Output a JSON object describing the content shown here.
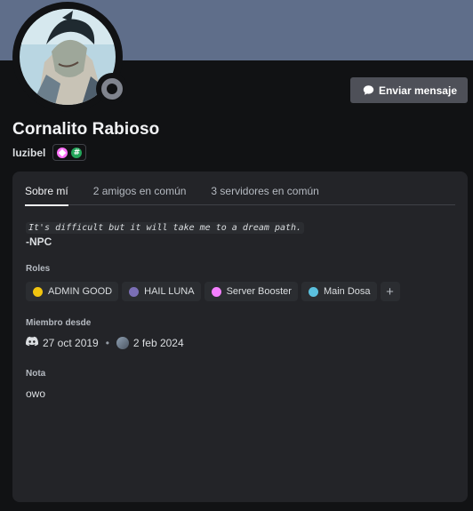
{
  "profile": {
    "display_name": "Cornalito Rabioso",
    "username": "luzibel",
    "badges": [
      "nitro-badge-icon",
      "hash-badge-icon"
    ],
    "hash_badge_text": "#",
    "status": "offline"
  },
  "actions": {
    "message_label": "Enviar mensaje"
  },
  "tabs": [
    {
      "label": "Sobre mí",
      "active": true
    },
    {
      "label": "2 amigos en común",
      "active": false
    },
    {
      "label": "3 servidores en común",
      "active": false
    }
  ],
  "bio": {
    "quote": "It's difficult but it will take me to a dream path.",
    "signature": "-NPC"
  },
  "roles": {
    "title": "Roles",
    "items": [
      {
        "name": "ADMIN GOOD",
        "color": "#f1c40f"
      },
      {
        "name": "HAIL LUNA",
        "color": "#7b6fb5"
      },
      {
        "name": "Server Booster",
        "color": "#f47fff"
      },
      {
        "name": "Main Dosa",
        "color": "#5bc0de"
      }
    ],
    "add_label": "+"
  },
  "member_since": {
    "title": "Miembro desde",
    "discord_date": "27 oct 2019",
    "separator": "•",
    "server_date": "2 feb 2024"
  },
  "note": {
    "title": "Nota",
    "value": "owo"
  },
  "colors": {
    "banner": "#5f6e8a",
    "background": "#111214",
    "card": "#232428",
    "button": "#4e5058"
  }
}
